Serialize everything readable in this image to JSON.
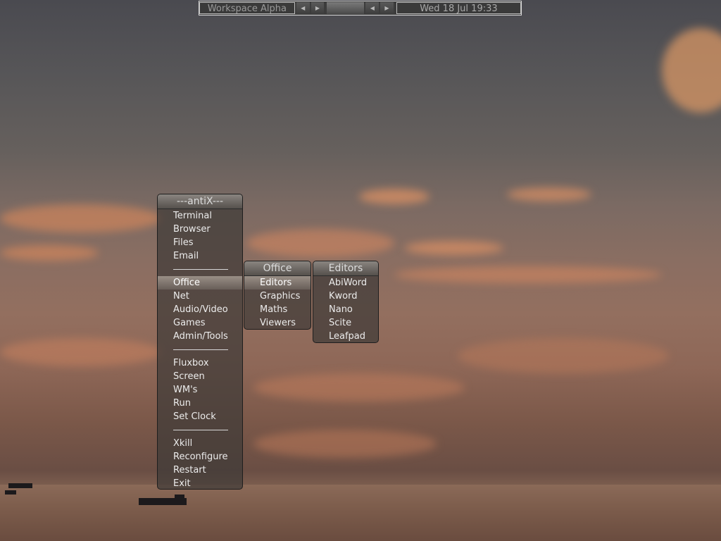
{
  "toolbar": {
    "workspace": "Workspace Alpha",
    "prev_workspace_icon": "triangle-left",
    "next_workspace_icon": "triangle-right",
    "prev_window_icon": "triangle-left",
    "next_window_icon": "triangle-right",
    "clock": "Wed 18 Jul  19:33"
  },
  "root_menu": {
    "title": "---antiX---",
    "items": [
      {
        "label": "Terminal"
      },
      {
        "label": "Browser"
      },
      {
        "label": "Files"
      },
      {
        "label": "Email"
      },
      {
        "separator": true
      },
      {
        "label": "Office",
        "active": true
      },
      {
        "label": "Net"
      },
      {
        "label": "Audio/Video"
      },
      {
        "label": "Games"
      },
      {
        "label": "Admin/Tools"
      },
      {
        "separator": true
      },
      {
        "label": "Fluxbox"
      },
      {
        "label": "Screen"
      },
      {
        "label": "WM's"
      },
      {
        "label": "Run"
      },
      {
        "label": "Set Clock"
      },
      {
        "separator": true
      },
      {
        "label": "Xkill"
      },
      {
        "label": "Reconfigure"
      },
      {
        "label": "Restart"
      },
      {
        "label": "Exit"
      }
    ]
  },
  "office_menu": {
    "title": "Office",
    "items": [
      {
        "label": "Editors",
        "active": true
      },
      {
        "label": "Graphics"
      },
      {
        "label": "Maths"
      },
      {
        "label": "Viewers"
      }
    ]
  },
  "editors_menu": {
    "title": "Editors",
    "items": [
      {
        "label": "AbiWord"
      },
      {
        "label": "Kword"
      },
      {
        "label": "Nano"
      },
      {
        "label": "Scite"
      },
      {
        "label": "Leafpad"
      }
    ]
  }
}
